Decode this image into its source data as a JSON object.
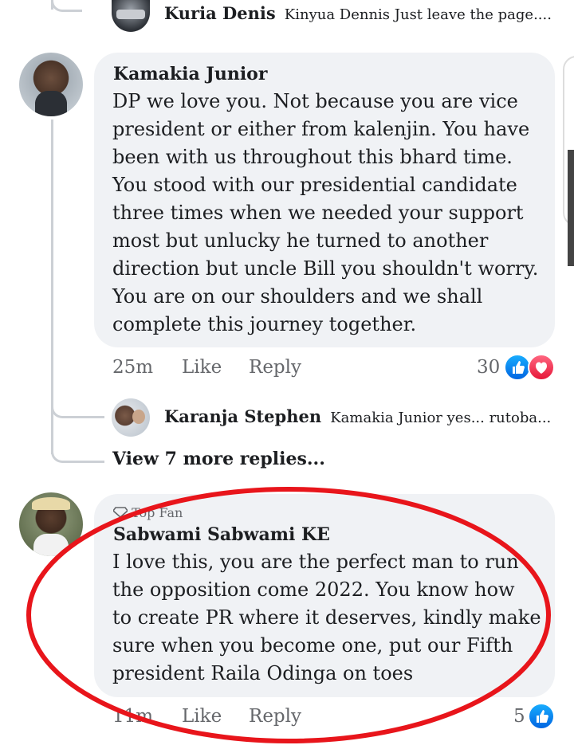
{
  "top_reply": {
    "name": "Kuria Denis",
    "text": "Kinyua Dennis  Just leave the page...."
  },
  "comment1": {
    "name": "Kamakia  Junior",
    "text": "DP we love you. Not because you are vice\npresident or either from kalenjin. You have\nbeen with us throughout this bhard time.\nYou stood with our presidential candidate\nthree times when we needed your support\nmost but unlucky he turned to another\ndirection but uncle Bill you shouldn't worry.\nYou are on our shoulders and we shall\ncomplete this journey together.",
    "time": "25m",
    "like_label": "Like",
    "reply_label": "Reply",
    "reaction_count": "30",
    "reactions": [
      "like-icon",
      "love-icon"
    ]
  },
  "reply2": {
    "name": "Karanja Stephen",
    "text": "Kamakia  Junior yes... rutoba..."
  },
  "view_more": "View 7 more replies...",
  "comment2": {
    "badge": "Top Fan",
    "name": "Sabwami Sabwami KE",
    "text": "I love this, you are the perfect man to run\nthe opposition come 2022. You know how\nto create PR where it deserves, kindly make\nsure when you become one, put our Fifth\npresident Raila Odinga on toes",
    "time": "11m",
    "like_label": "Like",
    "reply_label": "Reply",
    "reaction_count": "5",
    "reactions": [
      "like-icon"
    ]
  },
  "colors": {
    "bubble": "#f0f2f5",
    "annotation": "#e8151b",
    "like_blue": "#1877f2",
    "love_red": "#f33e58"
  }
}
